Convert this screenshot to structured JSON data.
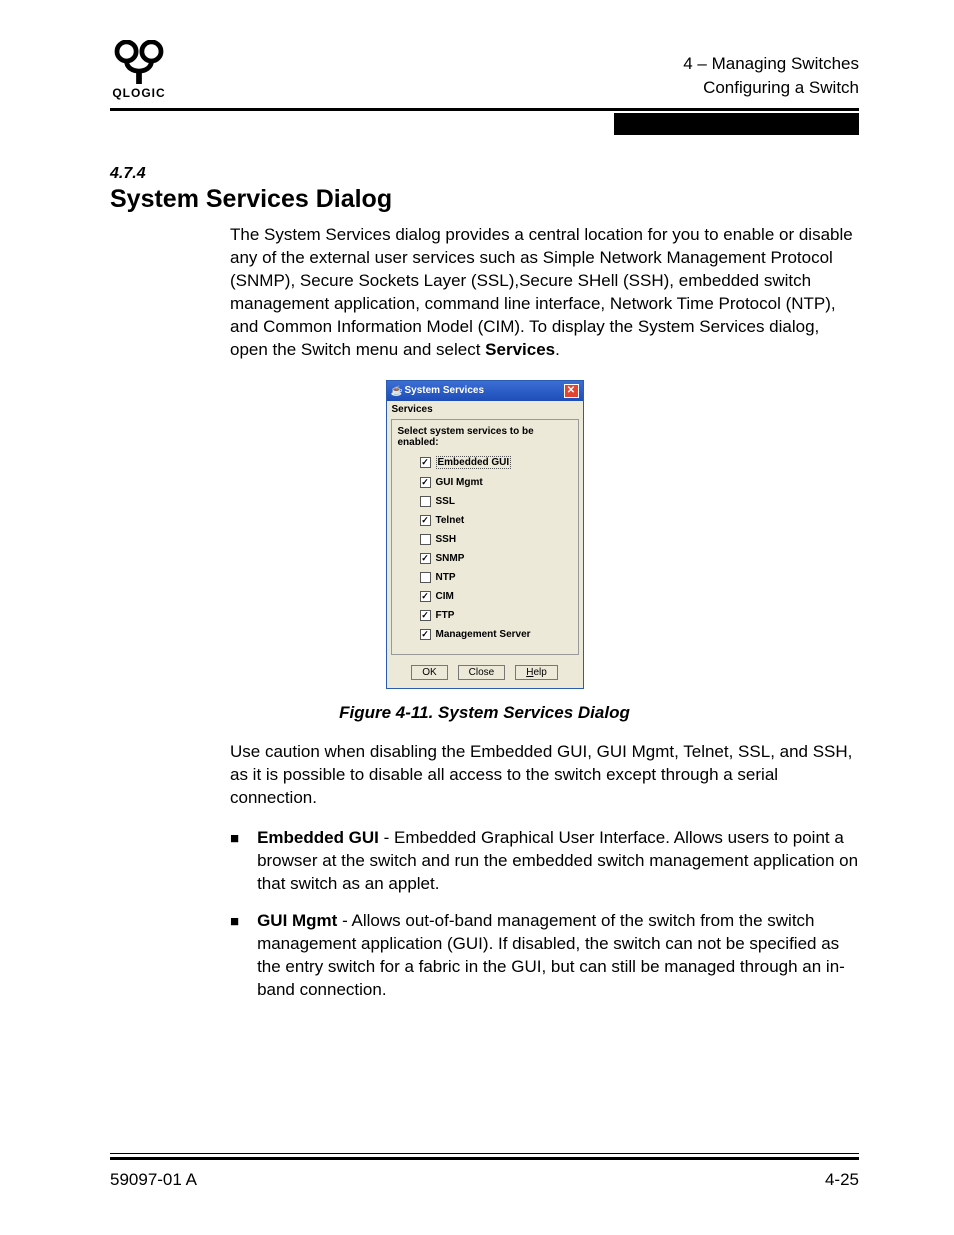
{
  "header": {
    "chapter_line": "4 – Managing Switches",
    "section_line": "Configuring a Switch",
    "logo_text": "QLOGIC"
  },
  "section": {
    "number": "4.7.4",
    "title": "System Services Dialog",
    "intro": "The System Services dialog provides a central location for you to enable or disable any of the external user services such as Simple Network Management Protocol (SNMP), Secure Sockets Layer (SSL),Secure SHell (SSH), embedded switch management application, command line interface, Network Time Protocol (NTP), and Common Information Model (CIM). To display the System Services dialog, open the Switch menu and select ",
    "intro_bold": "Services",
    "intro_tail": "."
  },
  "dialog": {
    "title": "System Services",
    "subtitle": "Services",
    "prompt": "Select system services to be enabled:",
    "items": [
      {
        "label": "Embedded GUI",
        "checked": true
      },
      {
        "label": "GUI Mgmt",
        "checked": true
      },
      {
        "label": "SSL",
        "checked": false
      },
      {
        "label": "Telnet",
        "checked": true
      },
      {
        "label": "SSH",
        "checked": false
      },
      {
        "label": "SNMP",
        "checked": true
      },
      {
        "label": "NTP",
        "checked": false
      },
      {
        "label": "CIM",
        "checked": true
      },
      {
        "label": "FTP",
        "checked": true
      },
      {
        "label": "Management Server",
        "checked": true
      }
    ],
    "buttons": {
      "ok": "OK",
      "close": "Close",
      "help_u": "H",
      "help_rest": "elp"
    }
  },
  "figure_caption": "Figure 4-11.  System Services Dialog",
  "caution_text": "Use caution when disabling the Embedded GUI, GUI Mgmt, Telnet, SSL, and SSH, as it is possible to disable all access to the switch except through a serial connection.",
  "bullets": [
    {
      "term": "Embedded GUI",
      "desc": " - Embedded Graphical User Interface. Allows users to point a browser at the switch and run the embedded switch management application on that switch as an applet."
    },
    {
      "term": "GUI Mgmt",
      "desc": " - Allows out-of-band management of the switch from the switch management application (GUI). If disabled, the switch can not be specified as the entry switch for a fabric in the GUI, but can still be managed through an in-band connection."
    }
  ],
  "footer": {
    "left": "59097-01 A",
    "right": "4-25"
  }
}
